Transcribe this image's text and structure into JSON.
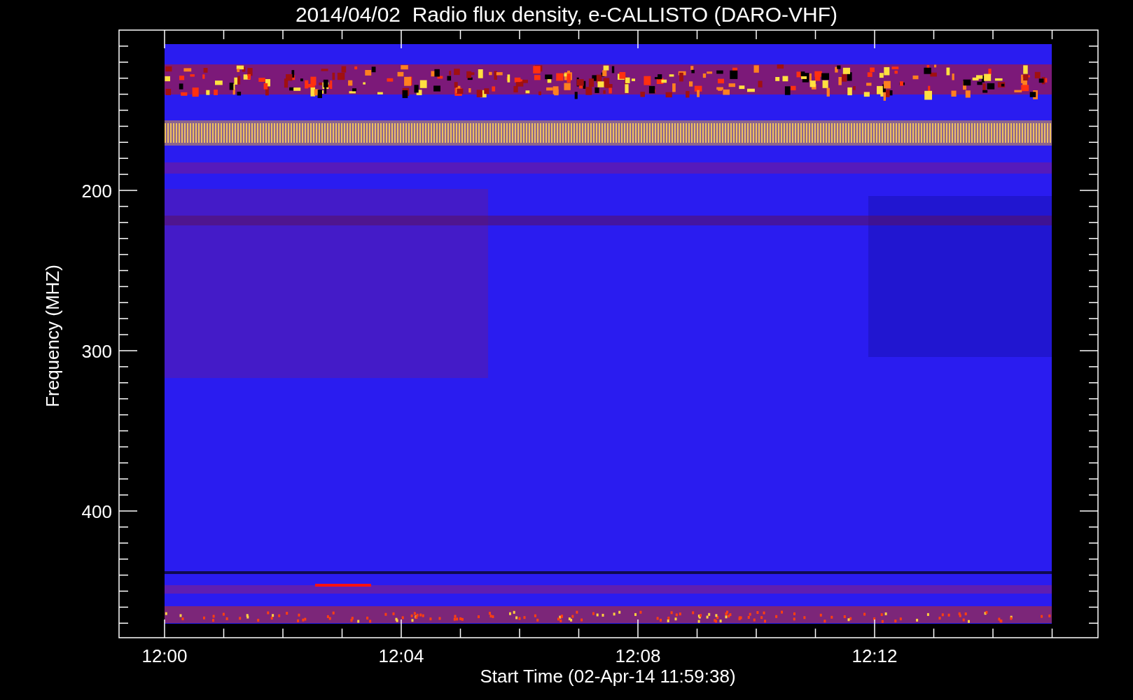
{
  "title": "2014/04/02  Radio flux density, e-CALLISTO (DARO-VHF)",
  "y_axis": {
    "label": "Frequency (MHZ)",
    "ticks": [
      "200",
      "300",
      "400"
    ]
  },
  "x_axis": {
    "label": "Start Time (02-Apr-14 11:59:38)",
    "ticks": [
      "12:00",
      "12:04",
      "12:08",
      "12:12"
    ]
  }
}
